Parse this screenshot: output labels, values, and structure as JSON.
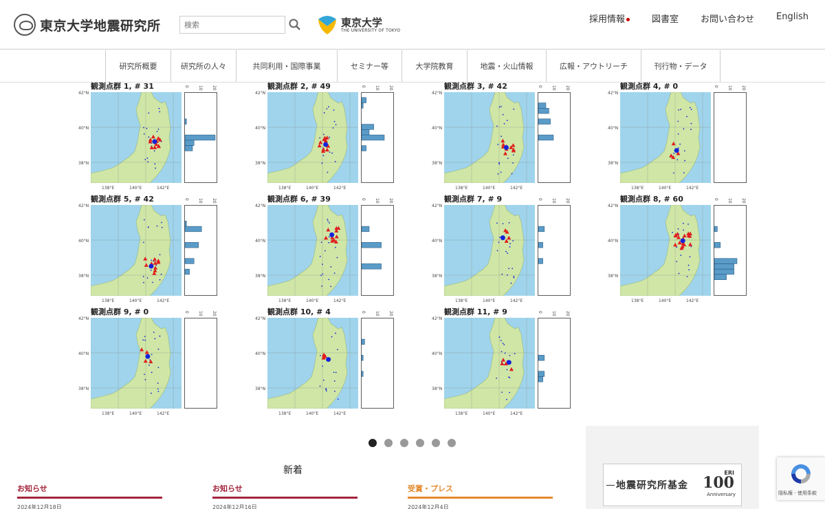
{
  "header": {
    "logo_text": "東京大学地震研究所",
    "search_placeholder": "検索",
    "ut_logo_jp": "東京大学",
    "ut_logo_en": "THE UNIVERSITY OF TOKYO",
    "top_links": [
      "採用情報",
      "図書室",
      "お問い合わせ",
      "English"
    ]
  },
  "nav": {
    "items": [
      "研究所概要",
      "研究所の人々",
      "共同利用・国際事業",
      "セミナー等",
      "大学院教育",
      "地震・火山情報",
      "広報・アウトリーチ",
      "刊行物・データ"
    ]
  },
  "slider": {
    "hist_ticks": [
      "0",
      "10",
      "20"
    ],
    "lat_labels": [
      "42°N",
      "40°N",
      "38°N"
    ],
    "lon_labels": [
      "138°E",
      "140°E",
      "142°E"
    ],
    "panels": [
      {
        "title": "観測点群 1, # 31",
        "hist": [
          0,
          0,
          0,
          0,
          0,
          1,
          0,
          0,
          20,
          6,
          5,
          0,
          0,
          0,
          0,
          0,
          0
        ]
      },
      {
        "title": "観測点群 2, # 49",
        "hist": [
          0,
          3,
          1,
          0,
          0,
          0,
          8,
          5,
          15,
          0,
          3,
          0,
          0,
          0,
          0,
          0,
          0
        ]
      },
      {
        "title": "観測点群 3, # 42",
        "hist": [
          0,
          0,
          5,
          7,
          0,
          8,
          0,
          0,
          10,
          0,
          0,
          0,
          0,
          0,
          0,
          0,
          0
        ]
      },
      {
        "title": "観測点群 4, # 0",
        "hist": [
          0,
          0,
          0,
          0,
          0,
          0,
          0,
          0,
          0,
          0,
          0,
          0,
          0,
          0,
          0,
          0,
          0
        ]
      },
      {
        "title": "観測点群 5, # 42",
        "hist": [
          0,
          0,
          0,
          1,
          11,
          0,
          0,
          9,
          0,
          0,
          6,
          0,
          3,
          0,
          0,
          0,
          0
        ]
      },
      {
        "title": "観測点群 6, # 39",
        "hist": [
          0,
          0,
          0,
          0,
          5,
          0,
          0,
          13,
          0,
          0,
          0,
          13,
          0,
          0,
          0,
          0,
          0
        ]
      },
      {
        "title": "観測点群 7, # 9",
        "hist": [
          0,
          0,
          0,
          0,
          4,
          0,
          0,
          3,
          0,
          0,
          3,
          0,
          0,
          0,
          0,
          0,
          0
        ]
      },
      {
        "title": "観測点群 8, # 60",
        "hist": [
          0,
          0,
          0,
          0,
          2,
          0,
          0,
          4,
          0,
          0,
          15,
          13,
          13,
          8,
          0,
          0,
          0
        ]
      },
      {
        "title": "観測点群 9, # 0",
        "hist": [
          0,
          0,
          0,
          0,
          0,
          0,
          0,
          0,
          0,
          0,
          0,
          0,
          0,
          0,
          0,
          0,
          0
        ]
      },
      {
        "title": "観測点群 10, # 4",
        "hist": [
          0,
          0,
          0,
          0,
          2,
          0,
          0,
          1,
          0,
          0,
          1,
          0,
          0,
          0,
          0,
          0,
          0
        ]
      },
      {
        "title": "観測点群 11, # 9",
        "hist": [
          0,
          0,
          0,
          0,
          0,
          0,
          0,
          4,
          0,
          0,
          4,
          3,
          0,
          0,
          0,
          0,
          0
        ]
      }
    ]
  },
  "dots": 6,
  "news": {
    "title": "新着",
    "items": [
      {
        "category": "お知らせ",
        "date": "2024年12月18日",
        "color": "#a4243b"
      },
      {
        "category": "お知らせ",
        "date": "2024年12月16日",
        "color": "#a4243b"
      },
      {
        "category": "受賞・プレス",
        "date": "2024年12月4日",
        "color": "#e58a2e"
      }
    ]
  },
  "fund": {
    "text": "地震研究所基金",
    "eri": "ERI",
    "num": "100",
    "anniv": "Anniversary"
  },
  "recaptcha": {
    "text": "隠私権 - 使用条款"
  },
  "colors": {
    "sea": "#9fd4ec",
    "land": "#cfe6a6",
    "station_triangle": "#e01e1e",
    "station_dot": "#1424d8",
    "bar": "#5a9bc8"
  }
}
